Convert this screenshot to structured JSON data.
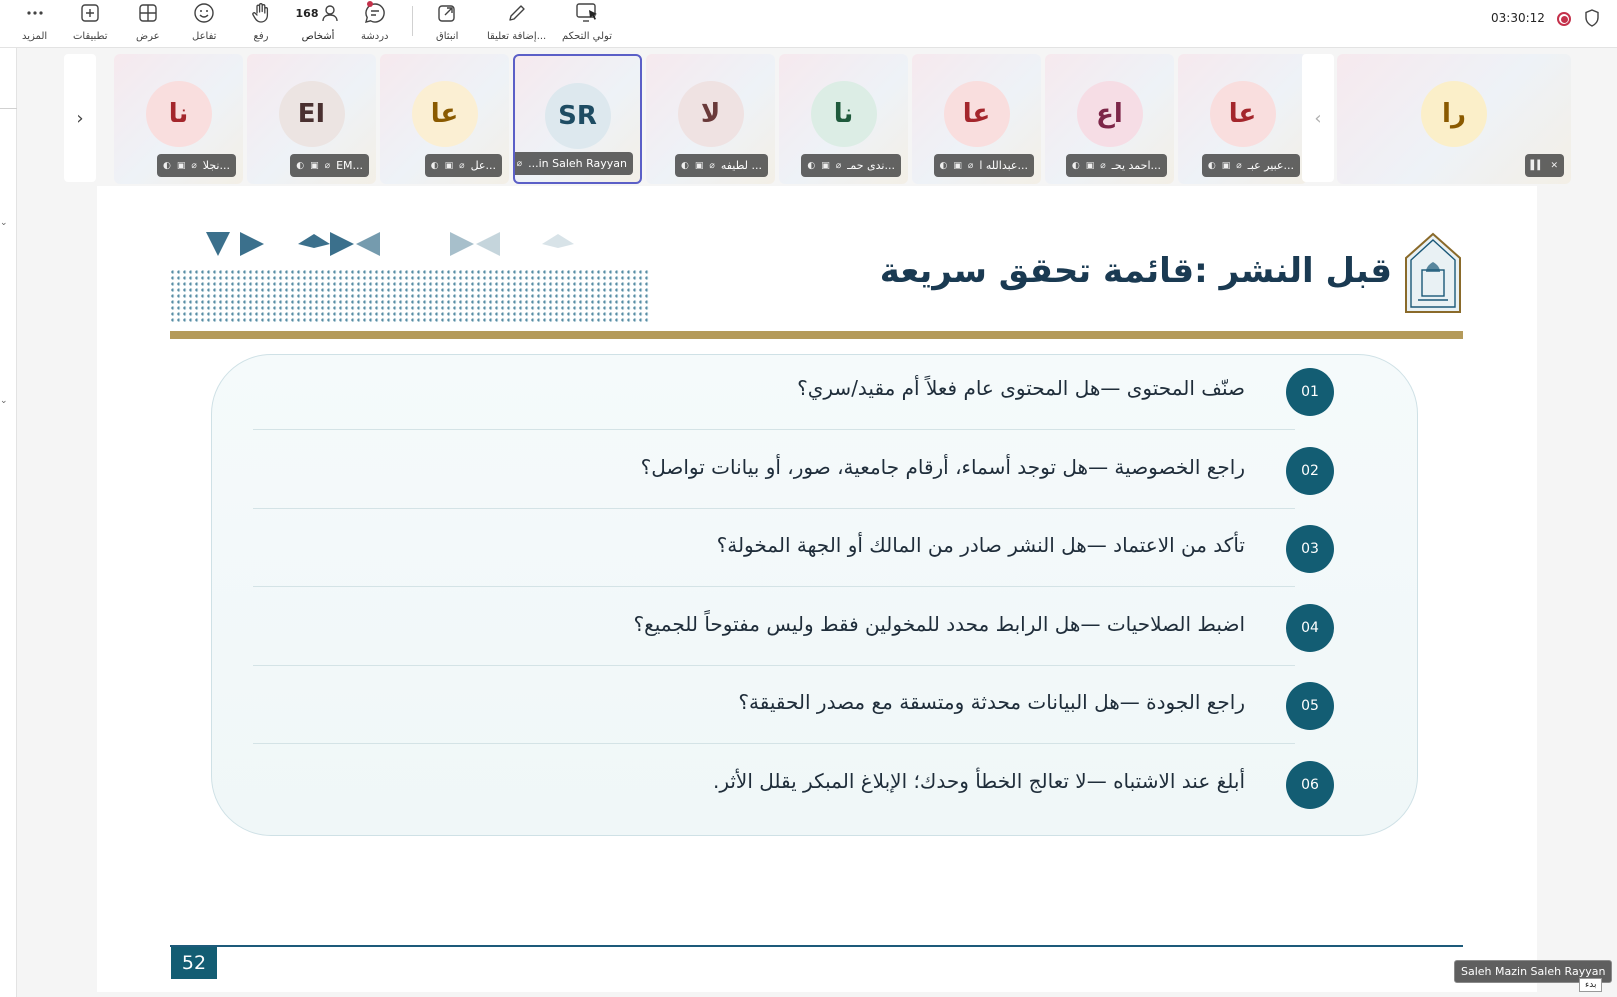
{
  "toolbar": {
    "more": "المزيد",
    "apps": "تطبيقات",
    "view": "عرض",
    "react": "تفاعل",
    "raise": "رفع",
    "people": "أشخاص",
    "people_count": "168",
    "chat": "دردشة",
    "popout": "انبثاق",
    "annotate": "إضافة تعليقا...",
    "take_control": "تولي التحكم",
    "timer": "03:30:12"
  },
  "participants": [
    {
      "initials": "نا",
      "name": "نجلا...",
      "bg": "#f9dede",
      "fg": "#a4262c"
    },
    {
      "initials": "EI",
      "name": "EM...",
      "bg": "#ece4e2",
      "fg": "#4a3030"
    },
    {
      "initials": "عا",
      "name": "عل...",
      "bg": "#fbefd3",
      "fg": "#8a5a00"
    },
    {
      "initials": "SR",
      "name": "...in Saleh Rayyan",
      "bg": "#dde8ee",
      "fg": "#1e4c63"
    },
    {
      "initials": "لا",
      "name": "لطيفه ...",
      "bg": "#efe2e2",
      "fg": "#6a3a3a"
    },
    {
      "initials": "نا",
      "name": "ندى حمـ...",
      "bg": "#dcede5",
      "fg": "#1f5a3c"
    },
    {
      "initials": "عا",
      "name": "عبدالله ا...",
      "bg": "#f9dede",
      "fg": "#a4262c"
    },
    {
      "initials": "اع",
      "name": "احمد يحـ...",
      "bg": "#f6dde5",
      "fg": "#7d2648"
    },
    {
      "initials": "عا",
      "name": "عبير عبـ...",
      "bg": "#f9dede",
      "fg": "#a4262c"
    },
    {
      "initials": "را",
      "name": "",
      "bg": "#fbefc9",
      "fg": "#8a5a00"
    }
  ],
  "slide": {
    "title": "قبل النشر :قائمة تحقق سريعة",
    "items": [
      {
        "num": "01",
        "text": "صنّف المحتوى  —هل المحتوى عام فعلاً أم مقيد/سري؟"
      },
      {
        "num": "02",
        "text": "راجع الخصوصية  —هل توجد أسماء، أرقام جامعية، صور، أو بيانات تواصل؟"
      },
      {
        "num": "03",
        "text": "تأكد من الاعتماد  —هل النشر صادر من المالك أو الجهة المخولة؟"
      },
      {
        "num": "04",
        "text": "اضبط الصلاحيات  —هل الرابط محدد للمخولين فقط وليس مفتوحاً للجميع؟"
      },
      {
        "num": "05",
        "text": "راجع الجودة  —هل البيانات محدثة ومتسقة مع مصدر الحقيقة؟"
      },
      {
        "num": "06",
        "text": "أبلغ عند الاشتباه  —لا تعالج الخطأ وحدك؛ الإبلاغ المبكر يقلل الأثر."
      }
    ],
    "page_number": "52"
  },
  "presenter_tooltip": "Saleh Mazin Saleh Rayyan",
  "small_tooltip": "بدء",
  "colors": {
    "accent": "#5b5fc7",
    "slide_teal": "#135d73",
    "gold": "#b49a5a",
    "record": "#c4314b"
  }
}
